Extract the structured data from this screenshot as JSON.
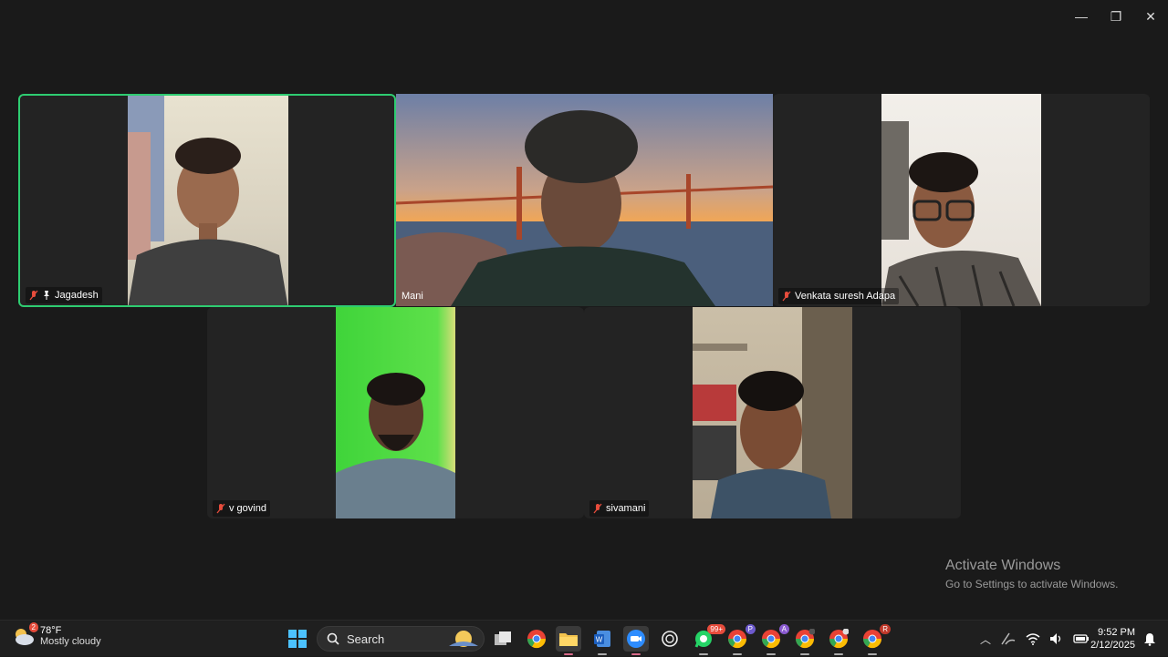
{
  "window": {
    "minimize": "—",
    "restore": "❐",
    "close": "✕"
  },
  "participants": [
    {
      "name": "Jagadesh",
      "muted": true,
      "pinned": true,
      "active": true
    },
    {
      "name": "Mani",
      "muted": false
    },
    {
      "name": "Venkata suresh Adapa",
      "muted": true
    },
    {
      "name": "v govind",
      "muted": true
    },
    {
      "name": "sivamani",
      "muted": true
    }
  ],
  "watermark": {
    "title": "Activate Windows",
    "subtitle": "Go to Settings to activate Windows."
  },
  "taskbar": {
    "weather": {
      "temp": "78°F",
      "desc": "Mostly cloudy",
      "badge": "2"
    },
    "search_label": "Search",
    "whatsapp_badge": "99+",
    "clock": {
      "time": "9:52 PM",
      "date": "2/12/2025"
    },
    "profile_letters": [
      "P",
      "A",
      "R"
    ]
  },
  "colors": {
    "active_border": "#2ecc71",
    "tile_bg": "#232323",
    "page_bg": "#1a1a1a"
  }
}
